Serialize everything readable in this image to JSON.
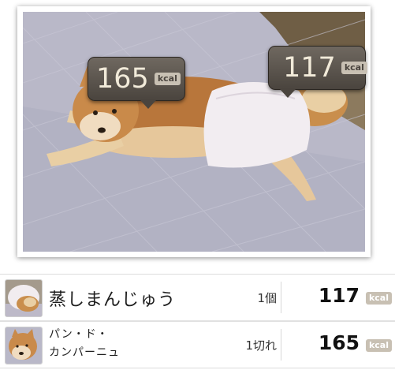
{
  "photo": {
    "labels": [
      {
        "value": "165",
        "unit": "kcal",
        "icon": "speech-bubble"
      },
      {
        "value": "117",
        "unit": "kcal",
        "icon": "speech-bubble"
      }
    ]
  },
  "items": [
    {
      "name": "蒸しまんじゅう",
      "quantity": "1個",
      "kcal": "117",
      "unit": "kcal"
    },
    {
      "name_line1": "パン・ド・",
      "name_line2": "カンパーニュ",
      "quantity": "1切れ",
      "kcal": "165",
      "unit": "kcal"
    }
  ],
  "colors": {
    "bubble": "#4a443e",
    "unit_badge": "#c8c0b3",
    "blanket": "#b9b8c8",
    "dog_fur": "#b8763b"
  }
}
